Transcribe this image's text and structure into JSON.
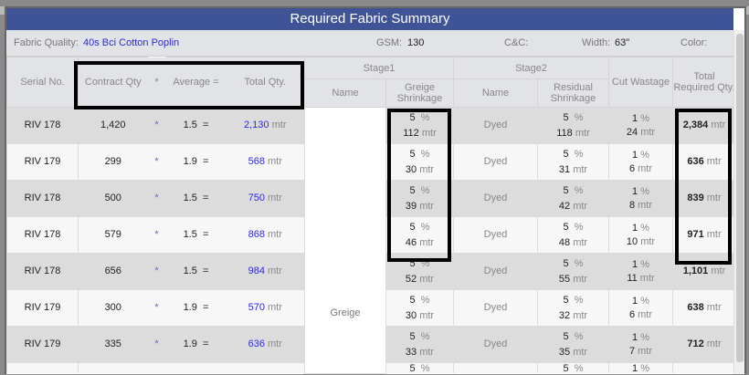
{
  "title": "Required Fabric Summary",
  "info": {
    "quality_label": "Fabric Quality:",
    "quality": "40s Bci Cotton Poplin",
    "gsm_label": "GSM:",
    "gsm": "130",
    "cc_label": "C&C:",
    "width_label": "Width:",
    "width": "63\"",
    "color_label": "Color:"
  },
  "headers": {
    "serial": "Serial No.",
    "contract": "Contract Qty",
    "star": "*",
    "average": "Average =",
    "total": "Total Qty.",
    "stage1": "Stage1",
    "stage2": "Stage2",
    "name1": "Name",
    "greige": "Greige Shrinkage",
    "name2": "Name",
    "residual": "Residual Shrinkage",
    "cut": "Cut Wastage",
    "required": "Total Required Qty."
  },
  "unit": "mtr",
  "pct": "%",
  "star": "*",
  "eq": "=",
  "stage1_name": "Greige",
  "rows": [
    {
      "serial": "RIV 178",
      "contract": "1,420",
      "avg": "1.5",
      "total": "2,130",
      "g_pct": "5",
      "g_qty": "112",
      "s2": "Dyed",
      "r_pct": "5",
      "r_qty": "118",
      "c_pct": "1",
      "c_qty": "24",
      "req": "2,384"
    },
    {
      "serial": "RIV 179",
      "contract": "299",
      "avg": "1.9",
      "total": "568",
      "g_pct": "5",
      "g_qty": "30",
      "s2": "Dyed",
      "r_pct": "5",
      "r_qty": "31",
      "c_pct": "1",
      "c_qty": "6",
      "req": "636"
    },
    {
      "serial": "RIV 178",
      "contract": "500",
      "avg": "1.5",
      "total": "750",
      "g_pct": "5",
      "g_qty": "39",
      "s2": "Dyed",
      "r_pct": "5",
      "r_qty": "42",
      "c_pct": "1",
      "c_qty": "8",
      "req": "839"
    },
    {
      "serial": "RIV 178",
      "contract": "579",
      "avg": "1.5",
      "total": "868",
      "g_pct": "5",
      "g_qty": "46",
      "s2": "Dyed",
      "r_pct": "5",
      "r_qty": "48",
      "c_pct": "1",
      "c_qty": "10",
      "req": "971"
    },
    {
      "serial": "RIV 178",
      "contract": "656",
      "avg": "1.5",
      "total": "984",
      "g_pct": "5",
      "g_qty": "52",
      "s2": "Dyed",
      "r_pct": "5",
      "r_qty": "55",
      "c_pct": "1",
      "c_qty": "11",
      "req": "1,101"
    },
    {
      "serial": "RIV 179",
      "contract": "300",
      "avg": "1.9",
      "total": "570",
      "g_pct": "5",
      "g_qty": "30",
      "s2": "Dyed",
      "r_pct": "5",
      "r_qty": "32",
      "c_pct": "1",
      "c_qty": "6",
      "req": "638"
    },
    {
      "serial": "RIV 179",
      "contract": "335",
      "avg": "1.9",
      "total": "636",
      "g_pct": "5",
      "g_qty": "33",
      "s2": "Dyed",
      "r_pct": "5",
      "r_qty": "35",
      "c_pct": "1",
      "c_qty": "7",
      "req": "712"
    }
  ],
  "partial": {
    "g_pct": "5",
    "r_pct": "5",
    "c_pct": "1"
  }
}
